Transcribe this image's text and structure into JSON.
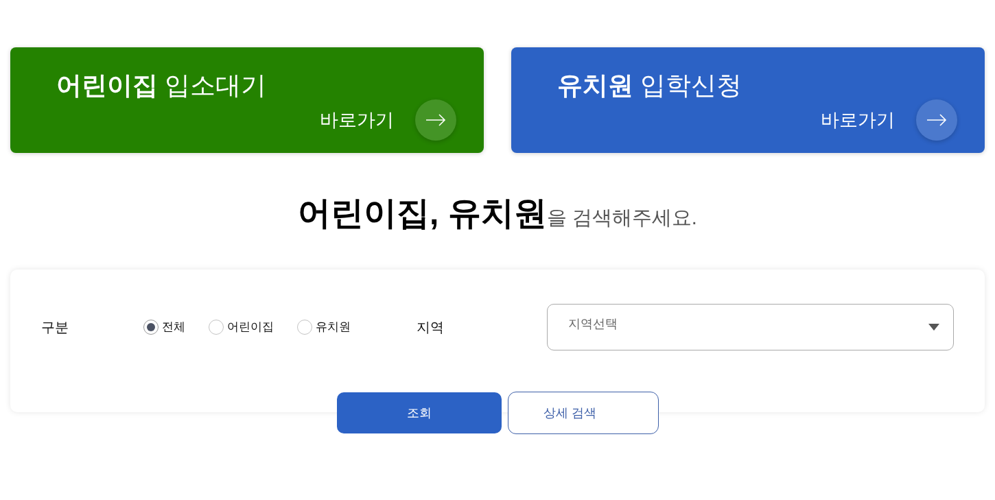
{
  "banners": [
    {
      "title": "**어린이집** 입소대기",
      "link": "바로가기",
      "color": "#248200"
    },
    {
      "title": "**유치원** 입학신청",
      "link": "바로가기",
      "color": "#2c62c5"
    }
  ],
  "heading": "**어린이집, 유치원**을 검색해주세요.",
  "search": {
    "type_label": "구분",
    "types": [
      {
        "label": "전체",
        "selected": true
      },
      {
        "label": "어린이집",
        "selected": false
      },
      {
        "label": "유치원",
        "selected": false
      }
    ],
    "region_label": "지역",
    "region_select": {
      "placeholder": "지역선택"
    }
  },
  "buttons": [
    {
      "label": "조회",
      "kind": "primary"
    },
    {
      "label": "상세 검색",
      "kind": "outline"
    }
  ]
}
